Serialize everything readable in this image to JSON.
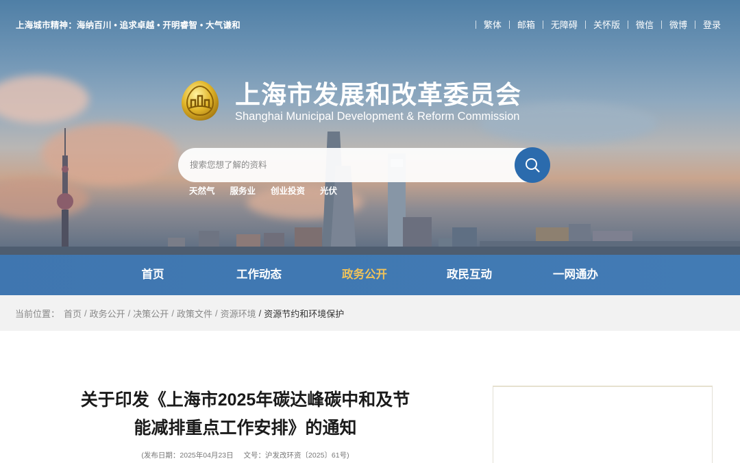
{
  "topbar": {
    "motto": "上海城市精神：海纳百川 • 追求卓越 • 开明睿智 • 大气谦和",
    "links": [
      "繁体",
      "邮箱",
      "无障碍",
      "关怀版",
      "微信",
      "微博",
      "登录"
    ]
  },
  "header": {
    "title": "上海市发展和改革委员会",
    "subtitle": "Shanghai Municipal Development & Reform Commission",
    "logo_icon": "shanghai-emblem-icon"
  },
  "search": {
    "placeholder": "搜索您想了解的资料",
    "button_icon": "search-icon",
    "hot_words": [
      "天然气",
      "服务业",
      "创业投资",
      "光伏"
    ]
  },
  "nav": {
    "items": [
      "首页",
      "工作动态",
      "政务公开",
      "政民互动",
      "一网通办"
    ],
    "active": "政务公开"
  },
  "breadcrumb": {
    "label": "当前位置：",
    "items": [
      "首页",
      "政务公开",
      "决策公开",
      "政策文件",
      "资源环境"
    ],
    "current": "资源节约和环境保护"
  },
  "article": {
    "title_line1": "关于印发《上海市2025年碳达峰碳中和及节",
    "title_line2": "能减排重点工作安排》的通知",
    "publish_date": "(发布日期：2025年04月23日",
    "doc_number": "文号：沪发改环资〔2025〕61号)"
  },
  "colors": {
    "nav_bg": "#2b6bad",
    "nav_active": "#f0c35a",
    "search_button": "#2b6bad",
    "breadcrumb_bg": "#f2f2f2"
  }
}
